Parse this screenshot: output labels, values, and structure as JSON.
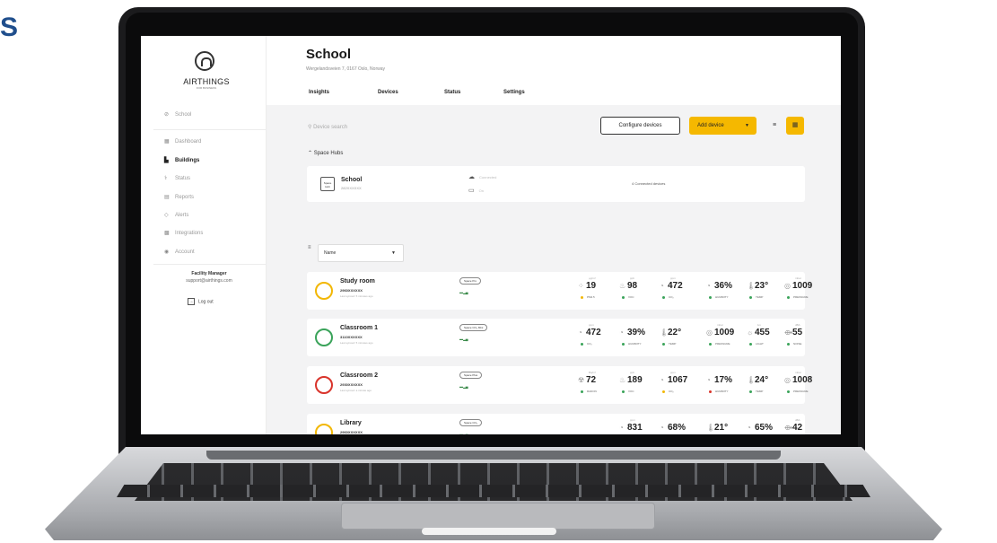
{
  "corner_text": "S",
  "sidebar": {
    "brand": "AIRTHINGS",
    "brand_sub": "FOR BUSINESS",
    "location": "School",
    "items": [
      {
        "icon": "dashboard-icon",
        "glyph": "▦",
        "label": "Dashboard",
        "active": false
      },
      {
        "icon": "buildings-icon",
        "glyph": "▙",
        "label": "Buildings",
        "active": true
      },
      {
        "icon": "status-icon",
        "glyph": "⚕",
        "label": "Status",
        "active": false
      },
      {
        "icon": "reports-icon",
        "glyph": "▤",
        "label": "Reports",
        "active": false
      },
      {
        "icon": "alerts-icon",
        "glyph": "◇",
        "label": "Alerts",
        "active": false
      },
      {
        "icon": "integrations-icon",
        "glyph": "▩",
        "label": "Integrations",
        "active": false
      },
      {
        "icon": "account-icon",
        "glyph": "◉",
        "label": "Account",
        "active": false
      }
    ],
    "user_name": "Facility Manager",
    "user_email": "support@airthings.com",
    "logout_label": "Log out"
  },
  "header": {
    "title": "School",
    "address": "Wergelandsveien 7, 0167 Oslo, Norway",
    "tabs": [
      "Insights",
      "Devices",
      "Status",
      "Settings"
    ]
  },
  "toolbar": {
    "search_placeholder": "Device search",
    "configure_label": "Configure devices",
    "add_label": "Add device"
  },
  "hubs_section": "Space Hubs",
  "hub": {
    "name": "School",
    "serial": "282XXXXXX",
    "connection": "Connected",
    "power": "On",
    "connected_devices": "4 Connected devices"
  },
  "sort_label": "Name",
  "colors": {
    "accent": "#f5b800",
    "good": "#3aa35a",
    "fair": "#f2b705",
    "poor": "#d9342b"
  },
  "devices": [
    {
      "name": "Study room",
      "serial": "2960XXXXXX",
      "synced": "Last synced: 5 minutes ago",
      "model": "Space Pro",
      "ring": "#f2b705",
      "metrics": [
        {
          "icon": "pm-icon",
          "glyph": "⁘",
          "value": "19",
          "unit": "µg/m³",
          "label": "PM2.5",
          "status": "#f2b705"
        },
        {
          "icon": "voc-icon",
          "glyph": "♨",
          "value": "98",
          "unit": "ppb",
          "label": "VOC",
          "status": "#3aa35a"
        },
        {
          "icon": "co2-icon",
          "glyph": "◔",
          "value": "472",
          "unit": "ppm",
          "label": "CO₂",
          "status": "#3aa35a"
        },
        {
          "icon": "humidity-icon",
          "glyph": "◔",
          "value": "36%",
          "unit": "",
          "label": "HUMIDITY",
          "status": "#3aa35a"
        },
        {
          "icon": "temp-icon",
          "glyph": "🌡",
          "value": "23°",
          "unit": "",
          "label": "TEMP",
          "status": "#3aa35a"
        },
        {
          "icon": "pressure-icon",
          "glyph": "◎",
          "value": "1009",
          "unit": "mbar",
          "label": "PRESSURE",
          "status": "#3aa35a"
        }
      ]
    },
    {
      "name": "Classroom 1",
      "serial": "3110XXXXXX",
      "synced": "Last synced: 5 minutes ago",
      "model": "Space CO₂ Mini",
      "ring": "#3aa35a",
      "metrics": [
        {
          "icon": "co2-icon",
          "glyph": "◔",
          "value": "472",
          "unit": "ppm",
          "label": "CO₂",
          "status": "#3aa35a"
        },
        {
          "icon": "humidity-icon",
          "glyph": "◔",
          "value": "39%",
          "unit": "",
          "label": "HUMIDITY",
          "status": "#3aa35a"
        },
        {
          "icon": "temp-icon",
          "glyph": "🌡",
          "value": "22°",
          "unit": "",
          "label": "TEMP",
          "status": "#3aa35a"
        },
        {
          "icon": "pressure-icon",
          "glyph": "◎",
          "value": "1009",
          "unit": "mbar",
          "label": "PRESSURE",
          "status": "#3aa35a"
        },
        {
          "icon": "light-icon",
          "glyph": "☼",
          "value": "455",
          "unit": "lux",
          "label": "LIGHT",
          "status": "#3aa35a"
        },
        {
          "icon": "noise-icon",
          "glyph": "⟴",
          "value": "55",
          "unit": "dBA",
          "label": "NOISE",
          "status": "#3aa35a"
        }
      ]
    },
    {
      "name": "Classroom 2",
      "serial": "2930XXXXXX",
      "synced": "Last synced: a minute ago",
      "model": "Space Plus",
      "ring": "#d9342b",
      "metrics": [
        {
          "icon": "radon-icon",
          "glyph": "☢",
          "value": "72",
          "unit": "Bq/m³",
          "label": "RADON",
          "status": "#3aa35a"
        },
        {
          "icon": "voc-icon",
          "glyph": "♨",
          "value": "189",
          "unit": "ppb",
          "label": "VOC",
          "status": "#3aa35a"
        },
        {
          "icon": "co2-icon",
          "glyph": "◔",
          "value": "1067",
          "unit": "ppm",
          "label": "CO₂",
          "status": "#f2b705"
        },
        {
          "icon": "humidity-icon",
          "glyph": "◔",
          "value": "17%",
          "unit": "",
          "label": "HUMIDITY",
          "status": "#d9342b"
        },
        {
          "icon": "temp-icon",
          "glyph": "🌡",
          "value": "24°",
          "unit": "",
          "label": "TEMP",
          "status": "#3aa35a"
        },
        {
          "icon": "pressure-icon",
          "glyph": "◎",
          "value": "1008",
          "unit": "mbar",
          "label": "PRESSURE",
          "status": "#3aa35a"
        }
      ]
    },
    {
      "name": "Library",
      "serial": "2960XXXXXX",
      "synced": "Last synced: a few seconds ago",
      "model": "Space CO₂",
      "ring": "#f2b705",
      "metrics": [
        {
          "icon": "co2-icon",
          "glyph": "◔",
          "value": "831",
          "unit": "ppm",
          "label": "CO₂",
          "status": "#3aa35a"
        },
        {
          "icon": "humidity-icon",
          "glyph": "◔",
          "value": "68%",
          "unit": "",
          "label": "HUMIDITY",
          "status": "#3aa35a"
        },
        {
          "icon": "temp-icon",
          "glyph": "🌡",
          "value": "21°",
          "unit": "",
          "label": "TEMP",
          "status": "#3aa35a"
        },
        {
          "icon": "rel-light-icon",
          "glyph": "◔",
          "value": "65%",
          "unit": "",
          "label": "REL LIGHT",
          "status": "#3aa35a"
        },
        {
          "icon": "noise-icon",
          "glyph": "⟴",
          "value": "42",
          "unit": "dBA",
          "label": "NOISE",
          "status": "#3aa35a"
        }
      ]
    }
  ]
}
